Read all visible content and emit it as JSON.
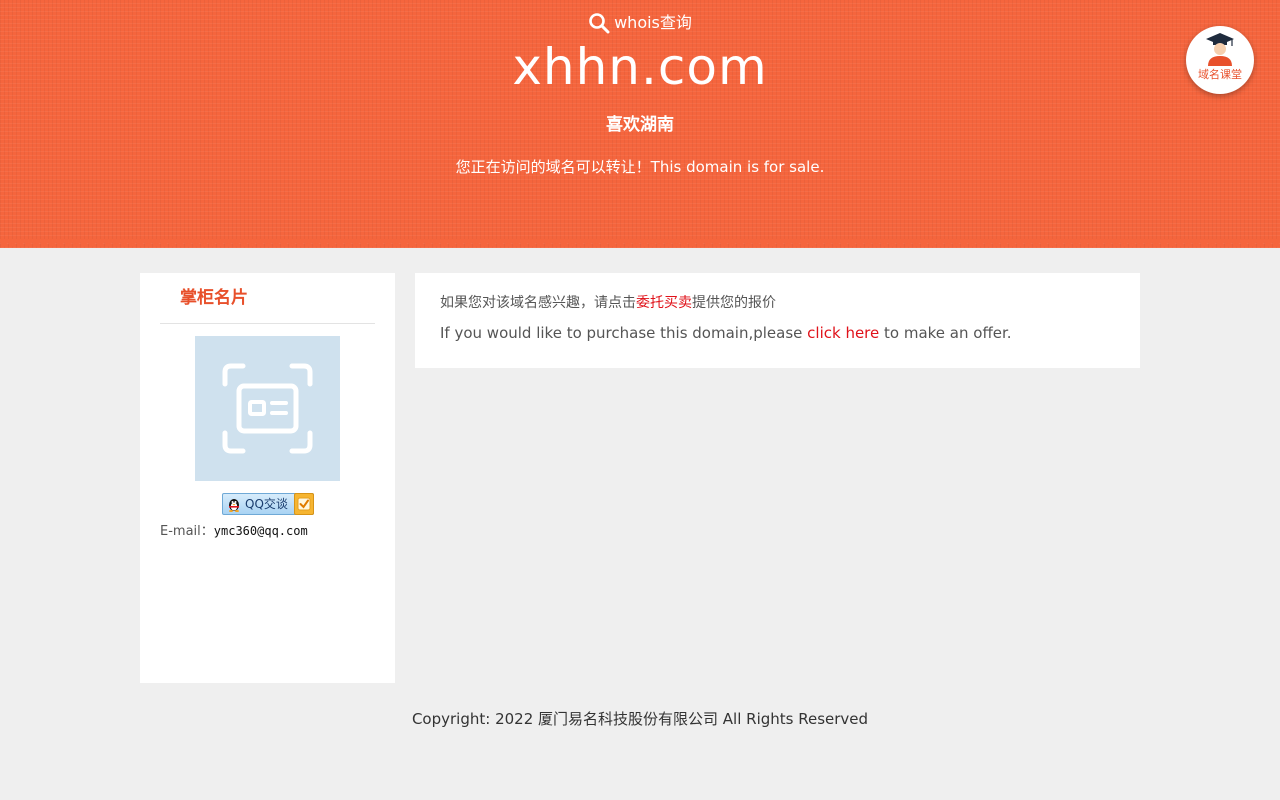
{
  "header": {
    "whois_label": "whois查询",
    "domain": "xhhn.com",
    "subtitle": "喜欢湖南",
    "sale_text": "您正在访问的域名可以转让！This domain is for sale.",
    "class_badge_label": "域名课堂",
    "accent_color": "#f5653d"
  },
  "card": {
    "title": "掌柜名片",
    "qq_label": "QQ交谈",
    "email_label": "E-mail：",
    "email": "ymc360@qq.com"
  },
  "panel": {
    "cn_prefix": "如果您对该域名感兴趣，请点击",
    "cn_link": "委托买卖",
    "cn_suffix": "提供您的报价",
    "en_prefix": "If you would like to purchase this domain,please ",
    "en_link": "click here",
    "en_suffix": " to make an offer."
  },
  "footer": {
    "copyright": "Copyright: 2022 厦门易名科技股份有限公司 All Rights Reserved"
  },
  "icons": {
    "search": "search-icon",
    "graduate": "graduate-icon",
    "card_placeholder": "card-placeholder-icon",
    "penguin": "qq-penguin-icon",
    "check": "check-icon"
  }
}
